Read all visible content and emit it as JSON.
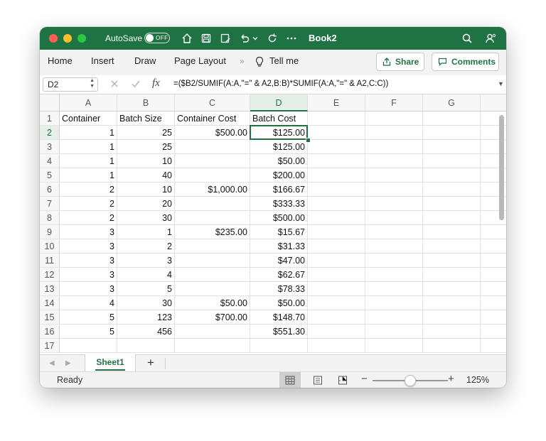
{
  "titlebar": {
    "autosave_label": "AutoSave",
    "autosave_state": "OFF",
    "title": "Book2"
  },
  "ribbon": {
    "tabs": [
      "Home",
      "Insert",
      "Draw",
      "Page Layout"
    ],
    "tell_me": "Tell me",
    "share_label": "Share",
    "comments_label": "Comments"
  },
  "formula_bar": {
    "name_box": "D2",
    "fx": "fx",
    "formula": "=($B2/SUMIF(A:A,\"=\" & A2,B:B)*SUMIF(A:A,\"=\" & A2,C:C))"
  },
  "sheet": {
    "columns": [
      "A",
      "B",
      "C",
      "D",
      "E",
      "F",
      "G"
    ],
    "rows": [
      {
        "n": "1",
        "a": "Container",
        "b": "Batch Size",
        "c": "Container Cost",
        "d": "Batch Cost"
      },
      {
        "n": "2",
        "a": "1",
        "b": "25",
        "c": "$500.00",
        "d": "$125.00"
      },
      {
        "n": "3",
        "a": "1",
        "b": "25",
        "c": "",
        "d": "$125.00"
      },
      {
        "n": "4",
        "a": "1",
        "b": "10",
        "c": "",
        "d": "$50.00"
      },
      {
        "n": "5",
        "a": "1",
        "b": "40",
        "c": "",
        "d": "$200.00"
      },
      {
        "n": "6",
        "a": "2",
        "b": "10",
        "c": "$1,000.00",
        "d": "$166.67"
      },
      {
        "n": "7",
        "a": "2",
        "b": "20",
        "c": "",
        "d": "$333.33"
      },
      {
        "n": "8",
        "a": "2",
        "b": "30",
        "c": "",
        "d": "$500.00"
      },
      {
        "n": "9",
        "a": "3",
        "b": "1",
        "c": "$235.00",
        "d": "$15.67"
      },
      {
        "n": "10",
        "a": "3",
        "b": "2",
        "c": "",
        "d": "$31.33"
      },
      {
        "n": "11",
        "a": "3",
        "b": "3",
        "c": "",
        "d": "$47.00"
      },
      {
        "n": "12",
        "a": "3",
        "b": "4",
        "c": "",
        "d": "$62.67"
      },
      {
        "n": "13",
        "a": "3",
        "b": "5",
        "c": "",
        "d": "$78.33"
      },
      {
        "n": "14",
        "a": "4",
        "b": "30",
        "c": "$50.00",
        "d": "$50.00"
      },
      {
        "n": "15",
        "a": "5",
        "b": "123",
        "c": "$700.00",
        "d": "$148.70"
      },
      {
        "n": "16",
        "a": "5",
        "b": "456",
        "c": "",
        "d": "$551.30"
      },
      {
        "n": "17",
        "a": "",
        "b": "",
        "c": "",
        "d": ""
      }
    ],
    "active_cell": "D2"
  },
  "sheet_tabs": {
    "active": "Sheet1",
    "add_label": "+"
  },
  "statusbar": {
    "status": "Ready",
    "zoom": "125%",
    "zoom_fraction": 0.5
  },
  "colors": {
    "accent": "#1f7244",
    "close": "#ff5f57",
    "minimize": "#febc2e",
    "zoom": "#28c840"
  }
}
